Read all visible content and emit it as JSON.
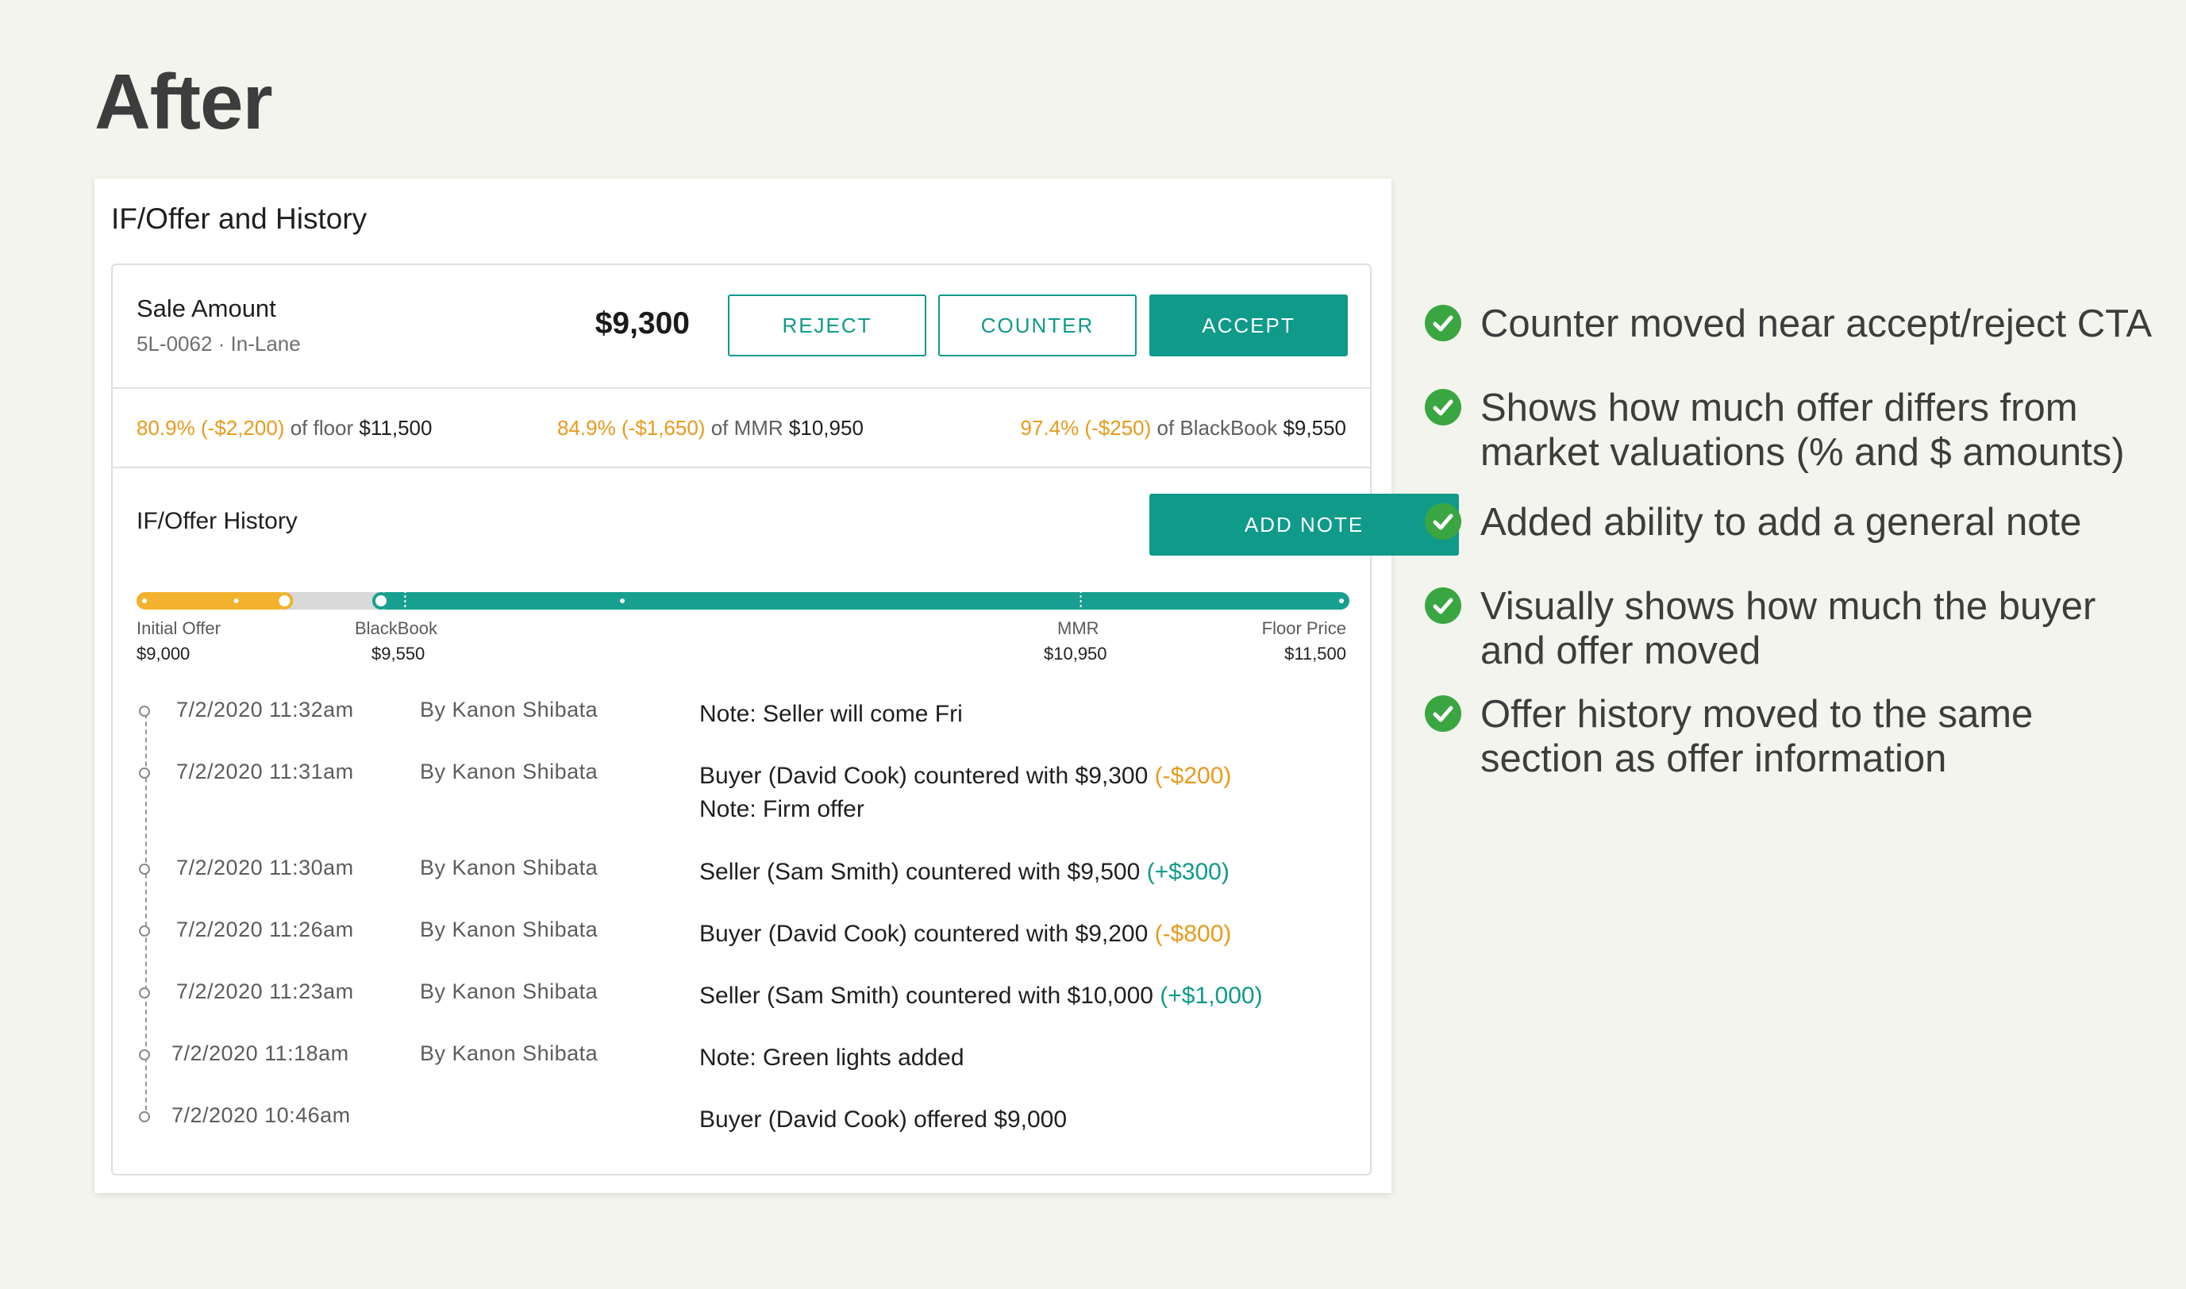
{
  "heading": "After",
  "card": {
    "title": "IF/Offer and History",
    "sale": {
      "label": "Sale Amount",
      "sub": "5L-0062 · In-Lane",
      "amount": "$9,300",
      "reject_label": "REJECT",
      "counter_label": "COUNTER",
      "accept_label": "ACCEPT"
    },
    "valuations": [
      {
        "pct": "80.9% (-$2,200)",
        "of": "of floor",
        "amount": "$11,500"
      },
      {
        "pct": "84.9% (-$1,650)",
        "of": "of MMR",
        "amount": "$10,950"
      },
      {
        "pct": "97.4% (-$250)",
        "of": "of BlackBook",
        "amount": "$9,550"
      }
    ],
    "history": {
      "label": "IF/Offer History",
      "add_note_label": "ADD NOTE",
      "range": {
        "min": 9000,
        "max": 11500,
        "buyer_value": 9300,
        "seller_value": 9500,
        "colors": {
          "buyer": "#f2b22e",
          "seller": "#17a08f",
          "gap": "#d9d9d9"
        }
      },
      "ticks": [
        {
          "label": "Initial Offer",
          "value": "$9,000"
        },
        {
          "label": "BlackBook",
          "value": "$9,550"
        },
        {
          "label": "MMR",
          "value": "$10,950"
        },
        {
          "label": "Floor Price",
          "value": "$11,500"
        }
      ],
      "entries": [
        {
          "date": "7/2/2020 11:32am",
          "by": "By Kanon Shibata",
          "text": "Note: Seller will come Fri",
          "delta": "",
          "note": ""
        },
        {
          "date": "7/2/2020 11:31am",
          "by": "By Kanon Shibata",
          "text": "Buyer (David Cook) countered with $9,300",
          "delta": "(-$200)",
          "note": "Note: Firm offer"
        },
        {
          "date": "7/2/2020 11:30am",
          "by": "By Kanon Shibata",
          "text": "Seller (Sam Smith) countered with $9,500",
          "delta": "(+$300)",
          "note": ""
        },
        {
          "date": "7/2/2020 11:26am",
          "by": "By Kanon Shibata",
          "text": "Buyer (David Cook) countered with $9,200",
          "delta": "(-$800)",
          "note": ""
        },
        {
          "date": "7/2/2020 11:23am",
          "by": "By Kanon Shibata",
          "text": "Seller (Sam Smith) countered with $10,000",
          "delta": "(+$1,000)",
          "note": ""
        },
        {
          "date": "7/2/2020 11:18am",
          "by": "By Kanon Shibata",
          "text": "Note: Green lights added",
          "delta": "",
          "note": ""
        },
        {
          "date": "7/2/2020 10:46am",
          "by": "",
          "text": "Buyer (David Cook) offered $9,000",
          "delta": "",
          "note": ""
        }
      ]
    }
  },
  "bullets": [
    "Counter moved near accept/reject CTA",
    "Shows how much offer differs from market valuations (% and $ amounts)",
    "Added ability to add a general note",
    "Visually shows how much the buyer and offer moved",
    "Offer history moved to the same section as offer information"
  ],
  "colors": {
    "accent": "#0f9a8a",
    "warning": "#e89a1c",
    "check": "#3aa642"
  }
}
